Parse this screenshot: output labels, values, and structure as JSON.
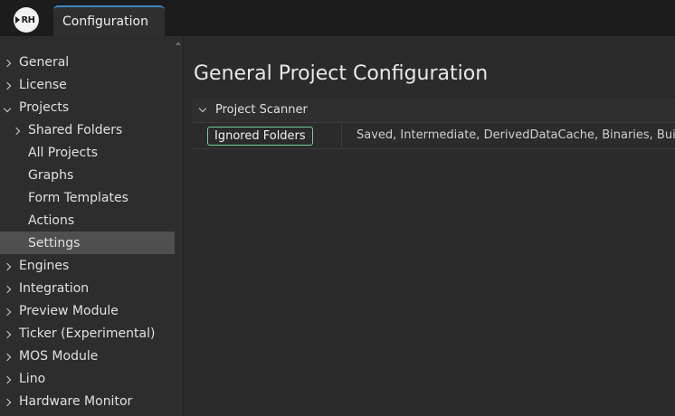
{
  "app": {
    "logo_text": "RH",
    "tab_label": "Configuration"
  },
  "sidebar": {
    "items": [
      {
        "label": "General",
        "expander": "right",
        "level": 0
      },
      {
        "label": "License",
        "expander": "right",
        "level": 0
      },
      {
        "label": "Projects",
        "expander": "down",
        "level": 0
      },
      {
        "label": "Shared Folders",
        "expander": "right",
        "level": 1
      },
      {
        "label": "All Projects",
        "expander": "none",
        "level": 1
      },
      {
        "label": "Graphs",
        "expander": "none",
        "level": 1
      },
      {
        "label": "Form Templates",
        "expander": "none",
        "level": 1
      },
      {
        "label": "Actions",
        "expander": "none",
        "level": 1
      },
      {
        "label": "Settings",
        "expander": "none",
        "level": 1,
        "selected": true
      },
      {
        "label": "Engines",
        "expander": "right",
        "level": 0
      },
      {
        "label": "Integration",
        "expander": "right",
        "level": 0
      },
      {
        "label": "Preview Module",
        "expander": "right",
        "level": 0
      },
      {
        "label": "Ticker (Experimental)",
        "expander": "right",
        "level": 0
      },
      {
        "label": "MOS Module",
        "expander": "right",
        "level": 0
      },
      {
        "label": "Lino",
        "expander": "right",
        "level": 0
      },
      {
        "label": "Hardware Monitor",
        "expander": "right",
        "level": 0
      }
    ]
  },
  "main": {
    "title": "General Project Configuration",
    "section": {
      "label": "Project Scanner",
      "rows": [
        {
          "key": "Ignored Folders",
          "value": "Saved, Intermediate, DerivedDataCache, Binaries, Build,"
        }
      ]
    }
  },
  "colors": {
    "background": "#2b2b2b",
    "topbar": "#1c1c1c",
    "selected": "#4f4f4f",
    "tab_accent": "#3a86c8",
    "pill_border": "#6fcf97"
  }
}
